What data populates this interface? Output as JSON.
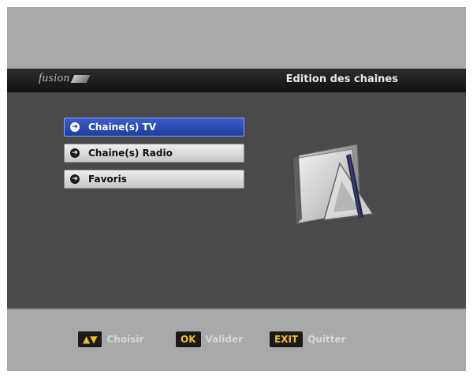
{
  "header": {
    "brand": "fusion",
    "title": "Edition des chaines"
  },
  "menu": {
    "items": [
      {
        "label": "Chaine(s) TV",
        "selected": true
      },
      {
        "label": "Chaine(s) Radio",
        "selected": false
      },
      {
        "label": "Favoris",
        "selected": false
      }
    ]
  },
  "footer": {
    "choose_key": "▲▼",
    "choose_label": "Choisir",
    "ok_key": "OK",
    "ok_label": "Valider",
    "exit_key": "EXIT",
    "exit_label": "Quitter"
  },
  "icons": {
    "menu_bullet": "arrow-circle-icon",
    "illustration": "folder-with-triangle-icon"
  },
  "colors": {
    "selected_item": "#2a4bb8",
    "key_text": "#f0c020"
  }
}
